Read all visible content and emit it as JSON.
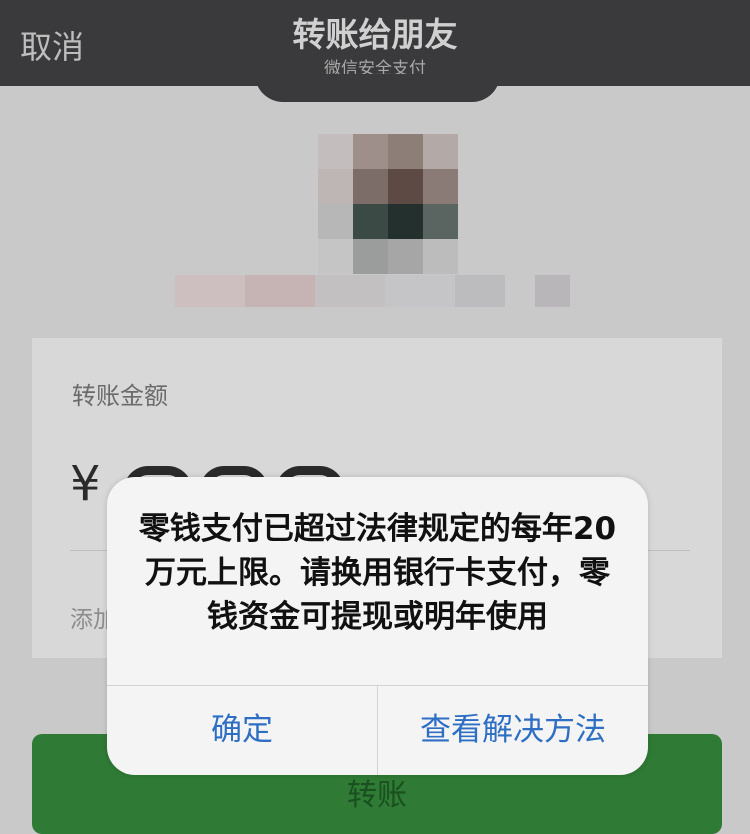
{
  "nav": {
    "cancel_label": "取消",
    "title": "转账给朋友",
    "subtitle": "微信安全支付"
  },
  "amount_card": {
    "label": "转账金额",
    "currency_symbol": "¥",
    "add_note_label": "添加"
  },
  "transfer_button": {
    "label": "转账"
  },
  "dialog": {
    "message": "零钱支付已超过法律规定的每年20万元上限。请换用银行卡支付，零钱资金可提现或明年使用",
    "confirm_label": "确定",
    "solution_label": "查看解决方法"
  },
  "colors": {
    "nav_bg": "#3a3a3c",
    "page_bg": "#c9c9c9",
    "button_green": "#2f7a34",
    "dialog_link_blue": "#2e6fc4"
  }
}
